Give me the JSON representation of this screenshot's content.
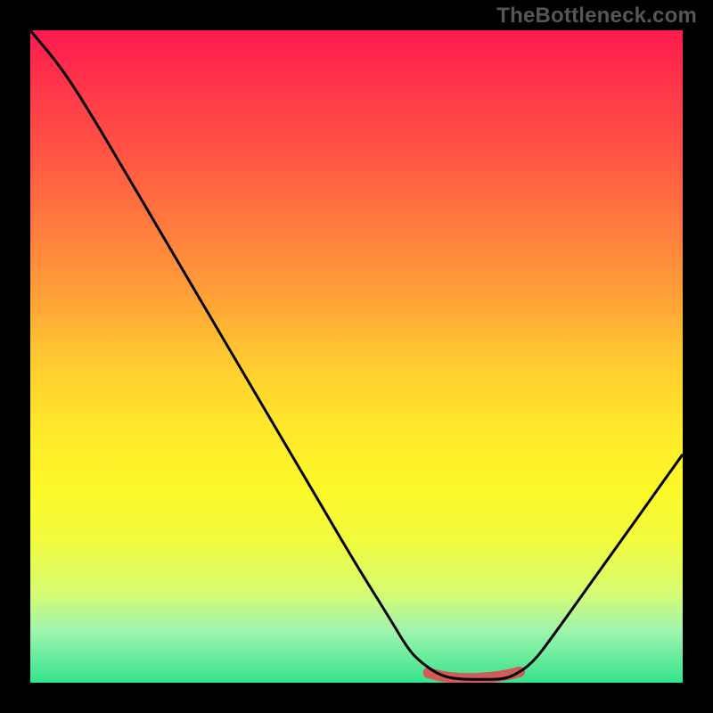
{
  "watermark": "TheBottleneck.com",
  "chart_data": {
    "type": "line",
    "title": "",
    "xlabel": "",
    "ylabel": "",
    "xlim": [
      0,
      100
    ],
    "ylim": [
      0,
      100
    ],
    "x": [
      0,
      5,
      10,
      15,
      20,
      25,
      30,
      35,
      40,
      45,
      50,
      55,
      58,
      60,
      63,
      66,
      69,
      72,
      74,
      77,
      80,
      85,
      90,
      95,
      100
    ],
    "y": [
      100,
      94,
      86,
      77.5,
      69,
      60.5,
      52,
      43.5,
      35,
      26.5,
      18,
      10,
      5,
      3,
      1,
      0.5,
      0.5,
      0.5,
      1,
      3,
      7,
      14,
      21,
      28,
      35
    ],
    "optimal_range": {
      "x_start": 61,
      "x_end": 75,
      "y": 0.7
    },
    "gradient_stops": [
      {
        "pct": 0,
        "hex": "#ff1a4e"
      },
      {
        "pct": 50,
        "hex": "#ffc831"
      },
      {
        "pct": 78,
        "hex": "#f2fb3e"
      },
      {
        "pct": 100,
        "hex": "#35e38d"
      }
    ],
    "colors": {
      "curve": "#000000",
      "optimal_marker": "#d35a55",
      "frame": "#000000"
    }
  }
}
